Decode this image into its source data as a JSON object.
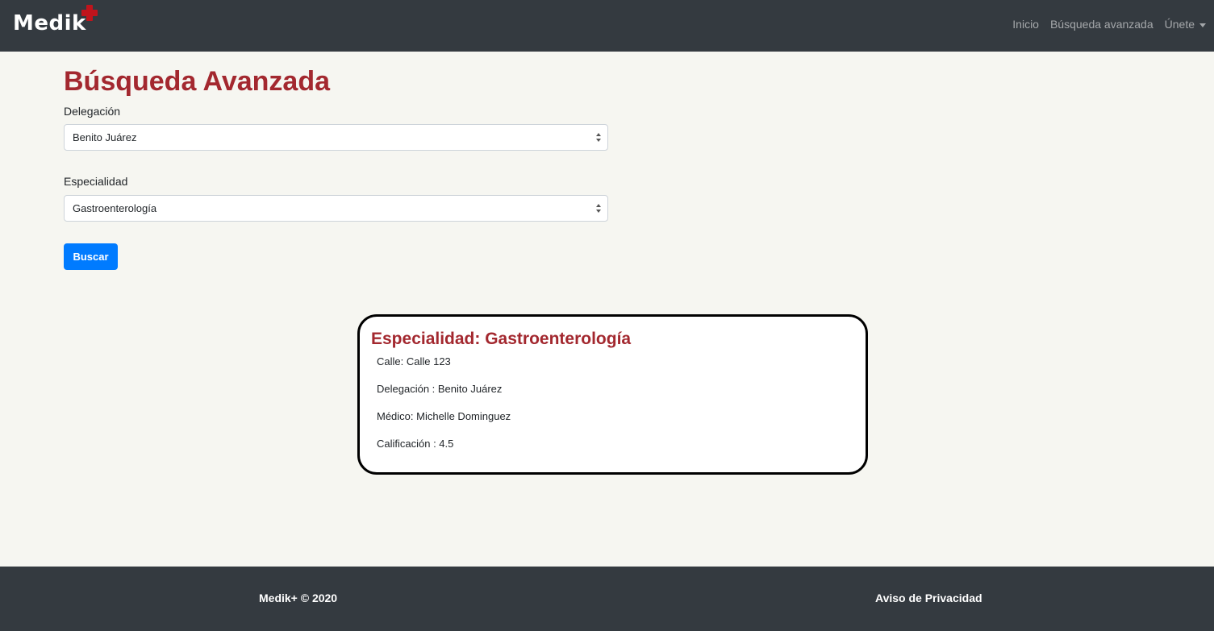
{
  "navbar": {
    "brand": "Medik",
    "brand_icon": "red-cross-icon",
    "links": [
      "Inicio",
      "Búsqueda avanzada",
      "Únete"
    ]
  },
  "main": {
    "title": "Búsqueda Avanzada",
    "delegacion": {
      "label": "Delegación",
      "selected": "Benito Juárez"
    },
    "especialidad": {
      "label": "Especialidad",
      "selected": "Gastroenterología"
    },
    "search_button": "Buscar"
  },
  "result": {
    "title": "Especialidad: Gastroenterología",
    "lines": [
      "Calle: Calle 123",
      "Delegación : Benito Juárez",
      "Médico: Michelle Dominguez",
      "Calificación : 4.5"
    ]
  },
  "footer": {
    "copyright": "Medik+ © 2020",
    "privacy": "Aviso de Privacidad"
  },
  "colors": {
    "navbar": "#343a40",
    "accent_red": "#a3282f",
    "button_blue": "#007bff",
    "background": "#f6f6f1"
  }
}
